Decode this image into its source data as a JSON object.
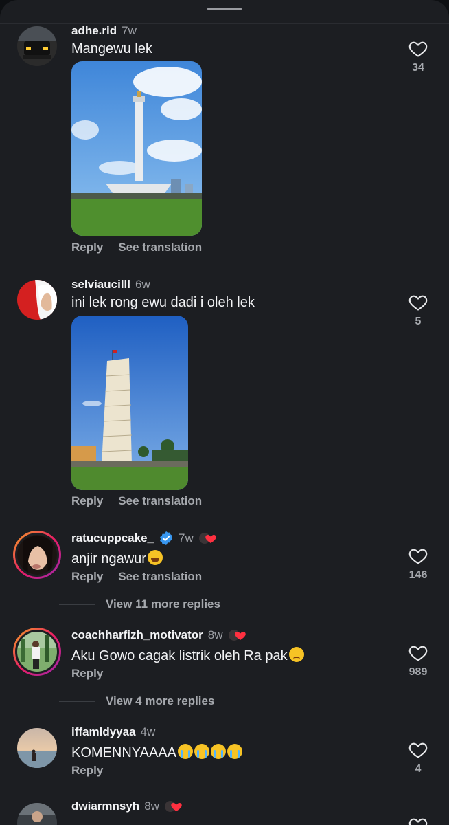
{
  "comments": [
    {
      "username": "adhe.rid",
      "time": "7w",
      "text": "Mangewu lek",
      "likes": "34",
      "actions": {
        "reply": "Reply",
        "translate": "See translation"
      }
    },
    {
      "username": "selviaucilll",
      "time": "6w",
      "text": "ini lek rong ewu dadi i oleh lek",
      "likes": "5",
      "actions": {
        "reply": "Reply",
        "translate": "See translation"
      }
    },
    {
      "username": "ratucuppcake_",
      "time": "7w",
      "text": "anjir ngawur",
      "likes": "146",
      "actions": {
        "reply": "Reply",
        "translate": "See translation"
      },
      "more_replies": "View 11 more replies"
    },
    {
      "username": "coachharfizh_motivator",
      "time": "8w",
      "text": "Aku Gowo cagak listrik oleh Ra pak",
      "likes": "989",
      "actions": {
        "reply": "Reply"
      },
      "more_replies": "View 4 more replies"
    },
    {
      "username": "iffamldyyaa",
      "time": "4w",
      "text": "KOMENNYAAAA",
      "likes": "4",
      "actions": {
        "reply": "Reply"
      }
    },
    {
      "username": "dwiarmnsyh",
      "time": "8w"
    }
  ],
  "icons": {
    "like": "heart-outline-icon",
    "verified": "verified-badge-icon",
    "creator_badge": "creator-heart-badge-icon"
  },
  "colors": {
    "background": "#1c1e22",
    "text_primary": "#f2f3f5",
    "text_secondary": "#a6a9ae",
    "verified_blue": "#3897f0"
  }
}
